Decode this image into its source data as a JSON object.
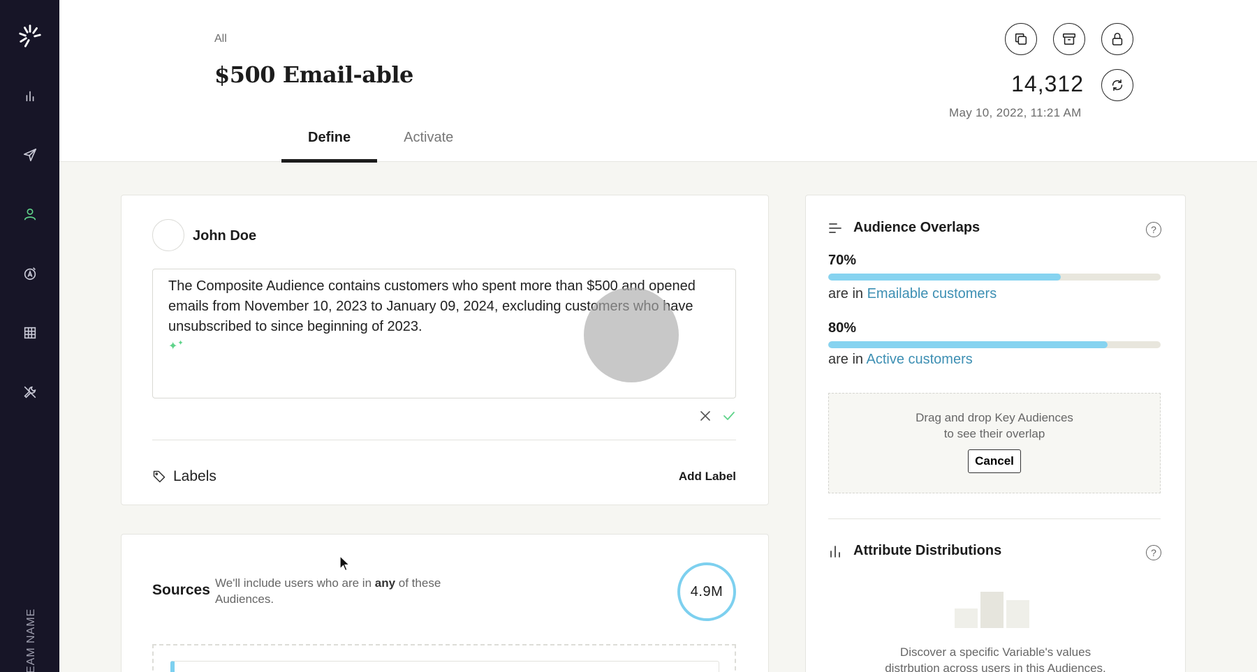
{
  "sidebar": {
    "team_name": "EAM NAME",
    "items": [
      {
        "icon": "bar-chart-icon"
      },
      {
        "icon": "send-icon"
      },
      {
        "icon": "user-icon",
        "active": true
      },
      {
        "icon": "compass-icon"
      },
      {
        "icon": "grid-icon"
      },
      {
        "icon": "wrench-icon"
      }
    ]
  },
  "header": {
    "breadcrumb": "All",
    "title": "$500 Email-able",
    "count": "14,312",
    "updated": "May 10, 2022, 11:21 AM",
    "tabs": [
      {
        "label": "Define",
        "active": true
      },
      {
        "label": "Activate",
        "active": false
      }
    ]
  },
  "description_card": {
    "author": "John Doe",
    "text": "The Composite Audience contains customers who spent more than $500 and opened emails from November 10, 2023 to January 09, 2024, excluding customers who have unsubscribed to since beginning of 2023.",
    "labels_title": "Labels",
    "add_label": "Add Label"
  },
  "sources_card": {
    "title": "Sources",
    "desc_pre": "We'll include users who are in ",
    "desc_bold": "any",
    "desc_post": " of these Audiences.",
    "count": "4.9M"
  },
  "overlaps": {
    "title": "Audience Overlaps",
    "items": [
      {
        "pct": "70%",
        "value": 0.7,
        "prefix": "are in ",
        "link": "Emailable customers"
      },
      {
        "pct": "80%",
        "value": 0.84,
        "prefix": "are in ",
        "link": "Active customers"
      }
    ],
    "drop_line1": "Drag and drop Key Audiences",
    "drop_line2": "to see their overlap",
    "cancel": "Cancel"
  },
  "distributions": {
    "title": "Attribute Distributions",
    "line1": "Discover a specific Variable's values",
    "line2": "distrbution across users in this Audiences."
  },
  "colors": {
    "accent": "#86d3f0",
    "link": "#3d8fb3",
    "active_icon": "#5fd38a",
    "sidebar_bg": "#171527"
  }
}
